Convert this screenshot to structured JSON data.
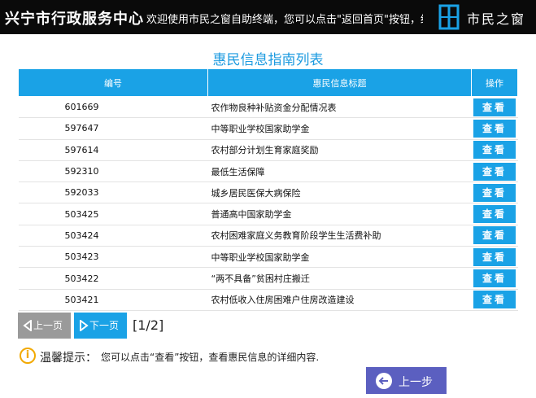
{
  "header": {
    "title": "兴宁市行政服务中心",
    "marquee": "欢迎使用市民之窗自助终端，您可以点击\"返回首页\"按钮，结",
    "logo_text": "市民之窗"
  },
  "list": {
    "title": "惠民信息指南列表",
    "columns": {
      "id": "编号",
      "title": "惠民信息标题",
      "action": "操作"
    },
    "view_label": "查看",
    "rows": [
      {
        "id": "601669",
        "title": "农作物良种补贴资金分配情况表"
      },
      {
        "id": "597647",
        "title": "中等职业学校国家助学金"
      },
      {
        "id": "597614",
        "title": "农村部分计划生育家庭奖励"
      },
      {
        "id": "592310",
        "title": "最低生活保障"
      },
      {
        "id": "592033",
        "title": "城乡居民医保大病保险"
      },
      {
        "id": "503425",
        "title": "普通高中国家助学金"
      },
      {
        "id": "503424",
        "title": "农村困难家庭义务教育阶段学生生活费补助"
      },
      {
        "id": "503423",
        "title": "中等职业学校国家助学金"
      },
      {
        "id": "503422",
        "title": "“两不具备”贫困村庄搬迁"
      },
      {
        "id": "503421",
        "title": "农村低收入住房困难户住房改造建设"
      }
    ]
  },
  "pagination": {
    "prev_label": "上一页",
    "next_label": "下一页",
    "page_indicator": "[1/2]"
  },
  "tip": {
    "label": "温馨提示：",
    "text": "您可以点击“查看”按钮，查看惠民信息的详细内容."
  },
  "back_button": {
    "label": "上一步"
  },
  "colors": {
    "accent": "#1aa2e6",
    "header_bg": "#0a0a0a",
    "back_button": "#5b5fc0",
    "disabled": "#9a9a9a",
    "tip_icon": "#f2a900"
  },
  "icons": {
    "prev": "chevron-left-icon",
    "next": "chevron-right-icon",
    "tip": "info-icon",
    "back": "back-arrow-icon"
  }
}
